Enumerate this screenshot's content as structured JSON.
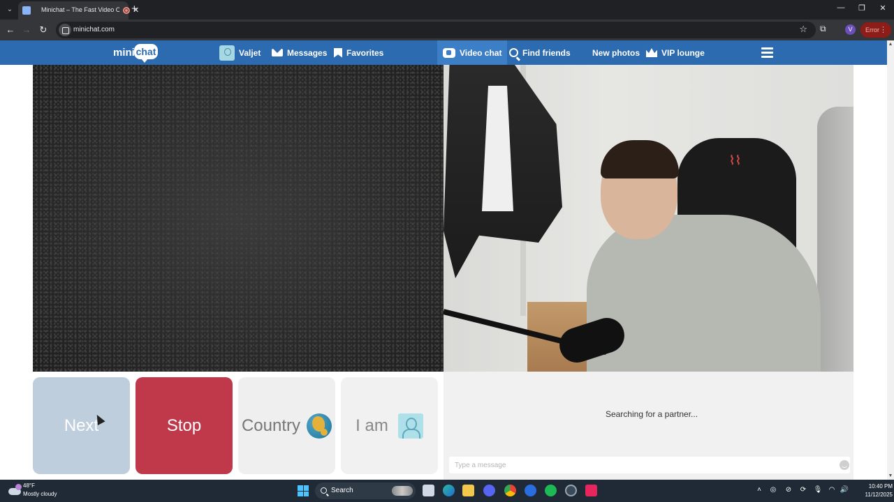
{
  "browser": {
    "tab_title": "Minichat – The Fast Video C",
    "url": "minichat.com",
    "error_label": "Error",
    "profile_initial": "V"
  },
  "site": {
    "logo_mini": "mini",
    "logo_chat": "chat",
    "nav": {
      "valjet": "Valjet",
      "messages": "Messages",
      "favorites": "Favorites",
      "video_chat": "Video chat",
      "find_friends": "Find friends",
      "new_photos": "New photos",
      "vip_lounge": "VIP lounge"
    },
    "active_nav": "video_chat",
    "accent_color": "#2d6bb0"
  },
  "controls": {
    "next_label": "Next",
    "stop_label": "Stop",
    "country_label": "Country",
    "iam_label": "I am",
    "stop_color": "#c0394a",
    "next_color": "#bfcedd"
  },
  "chat": {
    "status": "Searching for a partner...",
    "input_placeholder": "Type a message",
    "input_value": ""
  },
  "taskbar": {
    "temperature": "48°F",
    "weather": "Mostly cloudy",
    "search_label": "Search",
    "time": "10:40 PM",
    "date": "11/12/2025"
  }
}
